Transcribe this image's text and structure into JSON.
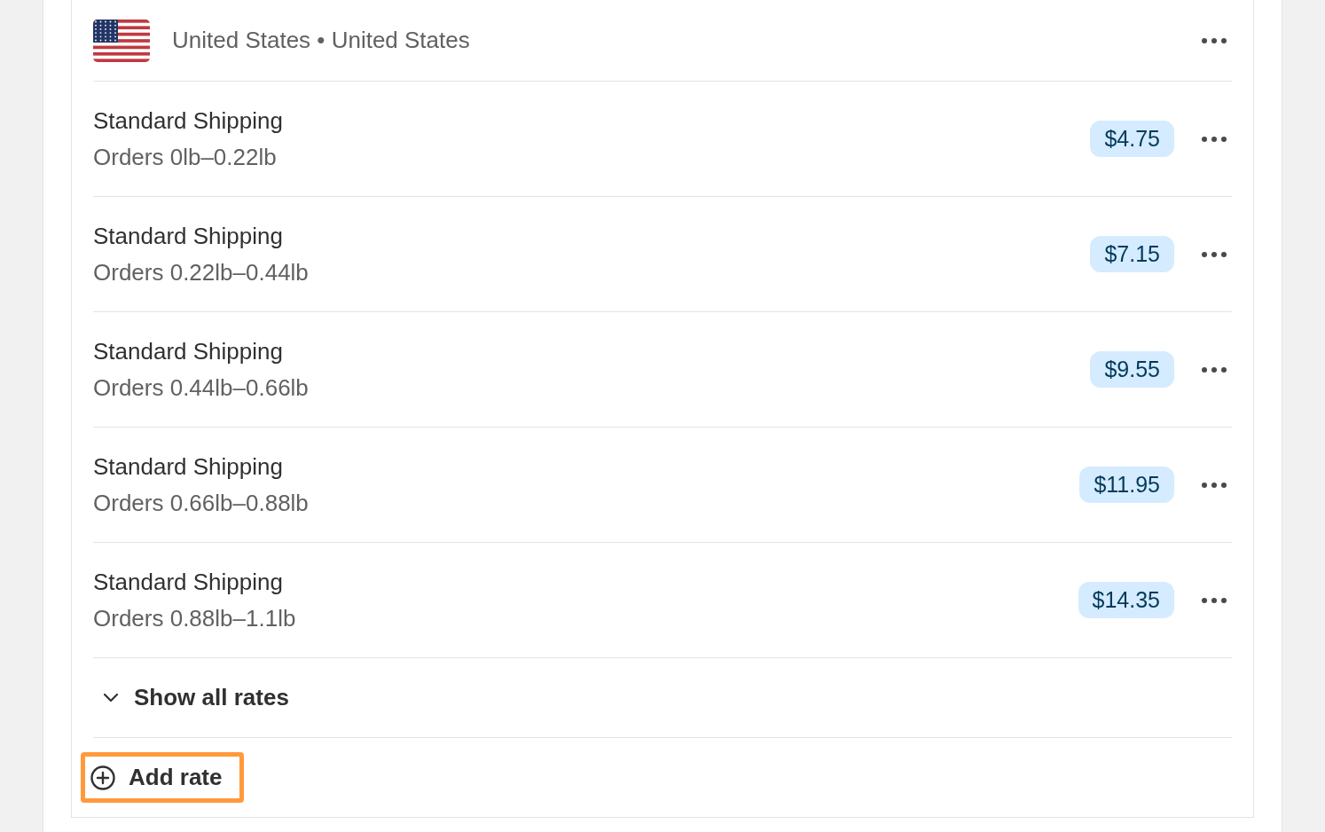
{
  "zone": {
    "country": "United States",
    "separator": "•",
    "region": "United States"
  },
  "rates": [
    {
      "name": "Standard Shipping",
      "condition": "Orders 0lb–0.22lb",
      "price": "$4.75"
    },
    {
      "name": "Standard Shipping",
      "condition": "Orders 0.22lb–0.44lb",
      "price": "$7.15"
    },
    {
      "name": "Standard Shipping",
      "condition": "Orders 0.44lb–0.66lb",
      "price": "$9.55"
    },
    {
      "name": "Standard Shipping",
      "condition": "Orders 0.66lb–0.88lb",
      "price": "$11.95"
    },
    {
      "name": "Standard Shipping",
      "condition": "Orders 0.88lb–1.1lb",
      "price": "$14.35"
    }
  ],
  "show_all": {
    "label": "Show all rates",
    "expanded": false
  },
  "add_rate": {
    "label": "Add rate",
    "highlighted": true
  }
}
